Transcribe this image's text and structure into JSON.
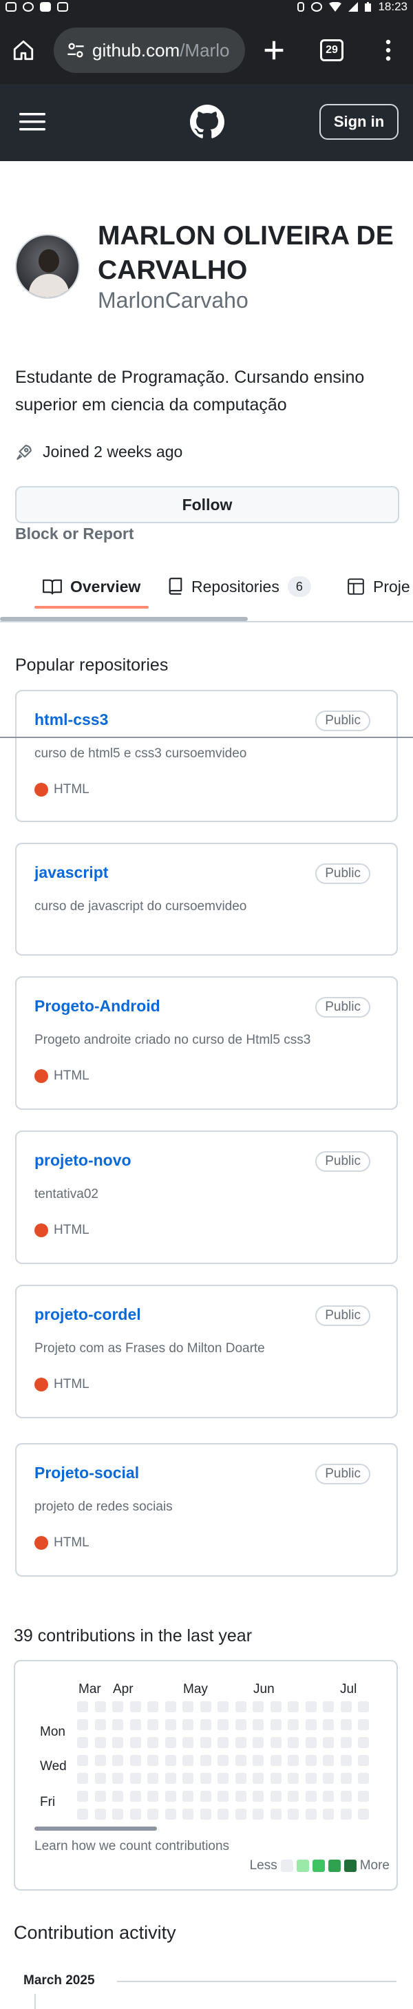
{
  "status_bar": {
    "time": "18:23",
    "icons": [
      "instagram-icon",
      "whatsapp-icon",
      "youtube-icon",
      "gallery-icon",
      "vibrate-icon",
      "alarm-icon",
      "wifi-icon",
      "signal-icon",
      "battery-icon"
    ]
  },
  "browser": {
    "url_host": "github.com",
    "url_rest": "/Marlo",
    "tab_count": "29"
  },
  "header": {
    "signin_label": "Sign in"
  },
  "profile": {
    "full_name": "MARLON OLIVEIRA DE CARVALHO",
    "username": "MarlonCarvaho",
    "bio": "Estudante de Programação. Cursando ensino superior em ciencia da computação",
    "joined": "Joined 2 weeks ago",
    "follow_label": "Follow",
    "block_label": "Block or Report"
  },
  "tabs": [
    {
      "label": "Overview",
      "counter": ""
    },
    {
      "label": "Repositories",
      "counter": "6"
    },
    {
      "label": "Proje",
      "counter": ""
    }
  ],
  "popular": {
    "title": "Popular repositories",
    "repos": [
      {
        "name": "html-css3",
        "visibility": "Public",
        "description": "curso de html5 e css3 cursoemvideo",
        "language": "HTML"
      },
      {
        "name": "javascript",
        "visibility": "Public",
        "description": "curso de javascript do cursoemvideo",
        "language": ""
      },
      {
        "name": "Progeto-Android",
        "visibility": "Public",
        "description": "Progeto androite criado no curso de Html5 css3",
        "language": "HTML"
      },
      {
        "name": "projeto-novo",
        "visibility": "Public",
        "description": "tentativa02",
        "language": "HTML"
      },
      {
        "name": "projeto-cordel",
        "visibility": "Public",
        "description": "Projeto com as Frases do Milton Doarte",
        "language": "HTML"
      },
      {
        "name": "Projeto-social",
        "visibility": "Public",
        "description": "projeto de redes sociais",
        "language": "HTML"
      }
    ]
  },
  "contributions": {
    "title": "39 contributions in the last year",
    "months": [
      "Mar",
      "Apr",
      "May",
      "Jun",
      "Jul"
    ],
    "days": [
      "Mon",
      "Wed",
      "Fri"
    ],
    "learn_text": "Learn how we count contributions",
    "legend_less": "Less",
    "legend_more": "More",
    "legend_colors": [
      "#ebedf0",
      "#9be9a8",
      "#40c463",
      "#30a14e",
      "#216e39"
    ]
  },
  "activity": {
    "title": "Contribution activity",
    "month": "March 2025"
  },
  "colors": {
    "link": "#0969da",
    "html_language": "#e34c26",
    "header_bg": "#24292f",
    "tab_underline": "#fd8c73"
  }
}
